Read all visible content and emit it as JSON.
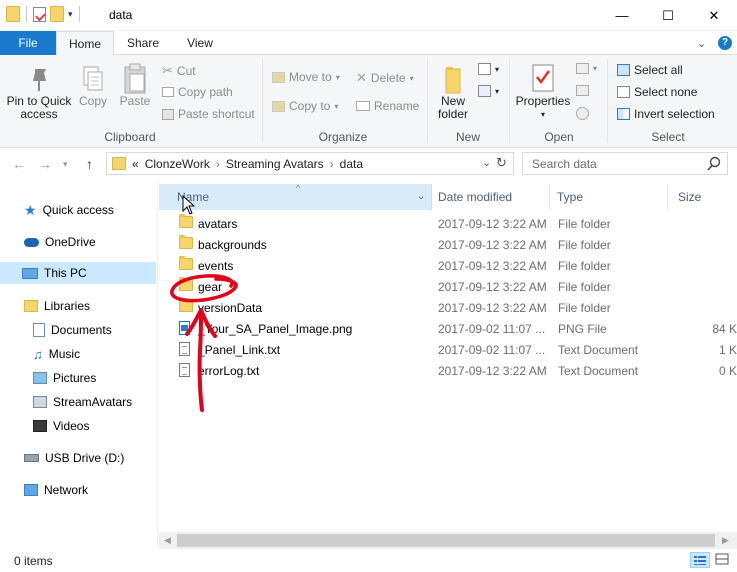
{
  "window": {
    "title": "data",
    "controls": {
      "minimize": "—",
      "maximize": "☐",
      "close": "✕"
    }
  },
  "ribbon_tabs": [
    {
      "label": "File"
    },
    {
      "label": "Home"
    },
    {
      "label": "Share"
    },
    {
      "label": "View"
    }
  ],
  "ribbon": {
    "clipboard": {
      "label": "Clipboard",
      "pin_to_quick_access": "Pin to Quick\naccess",
      "copy": "Copy",
      "paste": "Paste",
      "cut": "Cut",
      "copy_path": "Copy path",
      "paste_shortcut": "Paste shortcut"
    },
    "organize": {
      "label": "Organize",
      "move_to": "Move to",
      "copy_to": "Copy to",
      "delete": "Delete",
      "rename": "Rename"
    },
    "new": {
      "label": "New",
      "new_folder": "New\nfolder"
    },
    "open": {
      "label": "Open",
      "properties": "Properties"
    },
    "select": {
      "label": "Select",
      "select_all": "Select all",
      "select_none": "Select none",
      "invert_selection": "Invert selection"
    }
  },
  "address": {
    "prefix": "«",
    "crumbs": [
      "ClonzeWork",
      "Streaming Avatars",
      "data"
    ],
    "separator": "›"
  },
  "search": {
    "placeholder": "Search data"
  },
  "nav_pane": [
    {
      "label": "Quick access",
      "icon": "star-icon"
    },
    {
      "label": "OneDrive",
      "icon": "cloud-icon"
    },
    {
      "label": "This PC",
      "icon": "computer-icon",
      "selected": true
    },
    {
      "label": "Libraries",
      "icon": "libraries-icon"
    },
    {
      "label": "Documents",
      "icon": "documents-icon"
    },
    {
      "label": "Music",
      "icon": "music-icon"
    },
    {
      "label": "Pictures",
      "icon": "pictures-icon"
    },
    {
      "label": "StreamAvatars",
      "icon": "video-library-icon"
    },
    {
      "label": "Videos",
      "icon": "videos-icon"
    },
    {
      "label": "USB Drive (D:)",
      "icon": "usb-drive-icon"
    },
    {
      "label": "Network",
      "icon": "network-icon"
    }
  ],
  "columns": {
    "name": "Name",
    "date_modified": "Date modified",
    "type": "Type",
    "size": "Size"
  },
  "files": [
    {
      "name": "avatars",
      "date": "2017-09-12 3:22 AM",
      "type": "File folder",
      "size": "",
      "icon": "folder-icon"
    },
    {
      "name": "backgrounds",
      "date": "2017-09-12 3:22 AM",
      "type": "File folder",
      "size": "",
      "icon": "folder-icon"
    },
    {
      "name": "events",
      "date": "2017-09-12 3:22 AM",
      "type": "File folder",
      "size": "",
      "icon": "folder-icon"
    },
    {
      "name": "gear",
      "date": "2017-09-12 3:22 AM",
      "type": "File folder",
      "size": "",
      "icon": "folder-icon"
    },
    {
      "name": "versionData",
      "date": "2017-09-12 3:22 AM",
      "type": "File folder",
      "size": "",
      "icon": "folder-icon"
    },
    {
      "name": "_Your_SA_Panel_Image.png",
      "date": "2017-09-02 11:07 ...",
      "type": "PNG File",
      "size": "84 K",
      "icon": "png-file-icon"
    },
    {
      "name": "_Panel_Link.txt",
      "date": "2017-09-02 11:07 ...",
      "type": "Text Document",
      "size": "1 K",
      "icon": "text-file-icon"
    },
    {
      "name": "errorLog.txt",
      "date": "2017-09-12 3:22 AM",
      "type": "Text Document",
      "size": "0 K",
      "icon": "text-file-icon"
    }
  ],
  "status": {
    "item_count": "0 items"
  },
  "colors": {
    "accent": "#1979ca",
    "selection": "#cce8ff",
    "annotation": "#e3001b"
  }
}
